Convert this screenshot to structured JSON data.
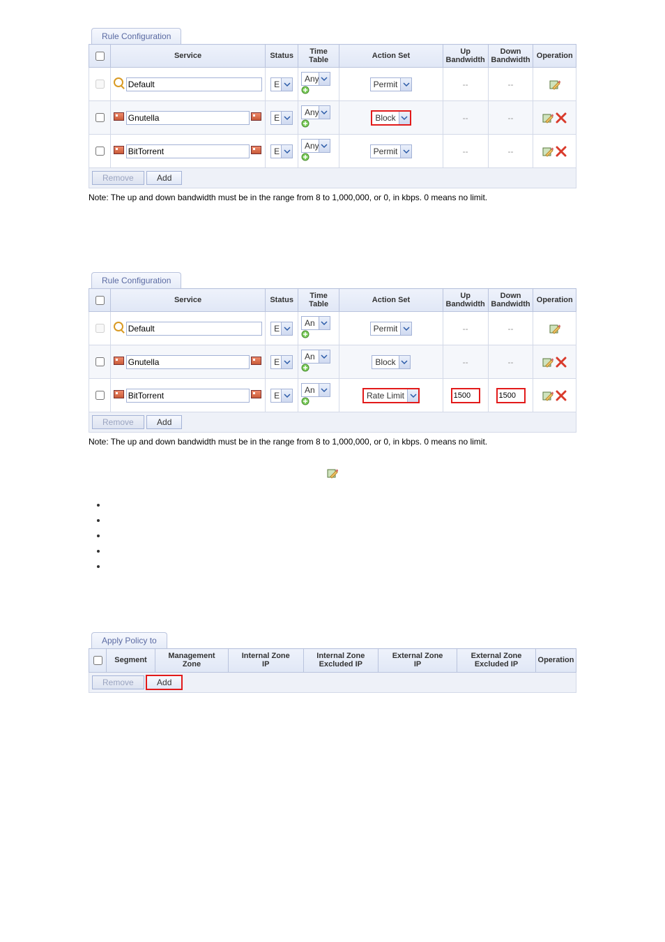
{
  "tabs": {
    "rule": "Rule Configuration",
    "apply": "Apply Policy to"
  },
  "cols": {
    "service": "Service",
    "status": "Status",
    "time_table": "Time Table",
    "time_table_2l": "Time\nTable",
    "action_set": "Action Set",
    "up_bw": "Up\nBandwidth",
    "down_bw": "Down\nBandwidth",
    "operation": "Operation"
  },
  "status_val": "E",
  "table1": {
    "tt_val": "Any",
    "rows": [
      {
        "kind": "default",
        "service": "Default",
        "action": "Permit",
        "up": "--",
        "down": "--",
        "ops": [
          "edit"
        ],
        "hlAction": false
      },
      {
        "kind": "cat",
        "service": "Gnutella",
        "action": "Block",
        "up": "--",
        "down": "--",
        "ops": [
          "edit",
          "del"
        ],
        "hlAction": true,
        "alt": true
      },
      {
        "kind": "cat",
        "service": "BitTorrent",
        "action": "Permit",
        "up": "--",
        "down": "--",
        "ops": [
          "edit",
          "del"
        ],
        "hlAction": false
      }
    ]
  },
  "table2": {
    "tt_val": "An",
    "rows": [
      {
        "kind": "default",
        "service": "Default",
        "action": "Permit",
        "up": "--",
        "down": "--",
        "ops": [
          "edit"
        ]
      },
      {
        "kind": "cat",
        "service": "Gnutella",
        "action": "Block",
        "up": "--",
        "down": "--",
        "ops": [
          "edit",
          "del"
        ],
        "alt": true
      },
      {
        "kind": "cat",
        "service": "BitTorrent",
        "action": "Rate Limit",
        "up": "1500",
        "down": "1500",
        "ops": [
          "edit",
          "del"
        ],
        "hlRow": true
      }
    ]
  },
  "btns": {
    "remove": "Remove",
    "add": "Add"
  },
  "note": "Note: The up and down bandwidth must be in the range from 8 to 1,000,000, or 0, in kbps. 0 means no limit.",
  "applyCols": {
    "segment": "Segment",
    "mgmt": "Management\nZone",
    "int_ip": "Internal Zone\nIP",
    "int_ex": "Internal Zone\nExcluded IP",
    "ext_ip": "External Zone\nIP",
    "ext_ex": "External Zone\nExcluded IP",
    "op": "Operation"
  }
}
